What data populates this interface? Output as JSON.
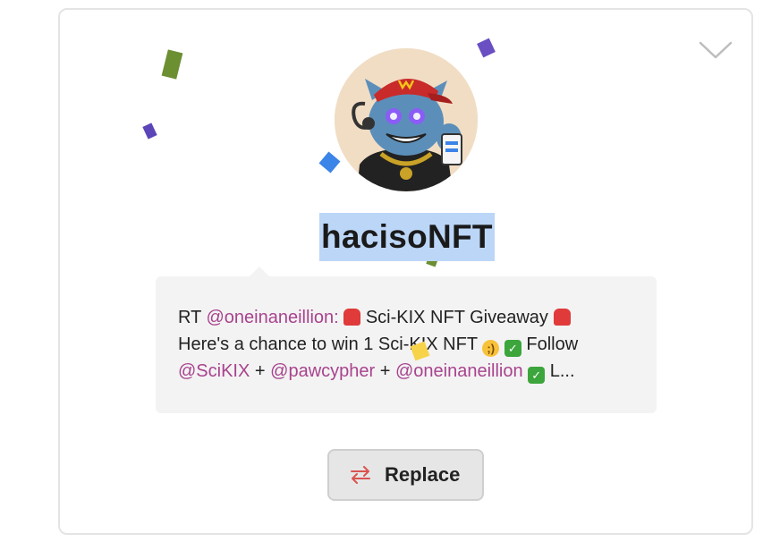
{
  "profile": {
    "username": "hacisoNFT",
    "avatar_icon": "cartoon-cat-avatar"
  },
  "tweet": {
    "prefix": "RT",
    "mention1": "@oneinaneillion:",
    "title": "Sci-KIX NFT Giveaway",
    "line2": "Here's a chance to win 1 Sci-KIX NFT",
    "follow": "Follow",
    "mention2": "@SciKIX",
    "plus": "+",
    "mention3": "@pawcypher",
    "mention4": "@oneinaneillion",
    "tail": "L..."
  },
  "actions": {
    "replace_label": "Replace",
    "replace_icon": "swap-arrows-icon",
    "expand_icon": "chevron-down-icon"
  },
  "colors": {
    "mention": "#a8438e",
    "selection": "#bcd6f8",
    "button_bg": "#e6e6e6",
    "replace_icon": "#d9534f"
  }
}
